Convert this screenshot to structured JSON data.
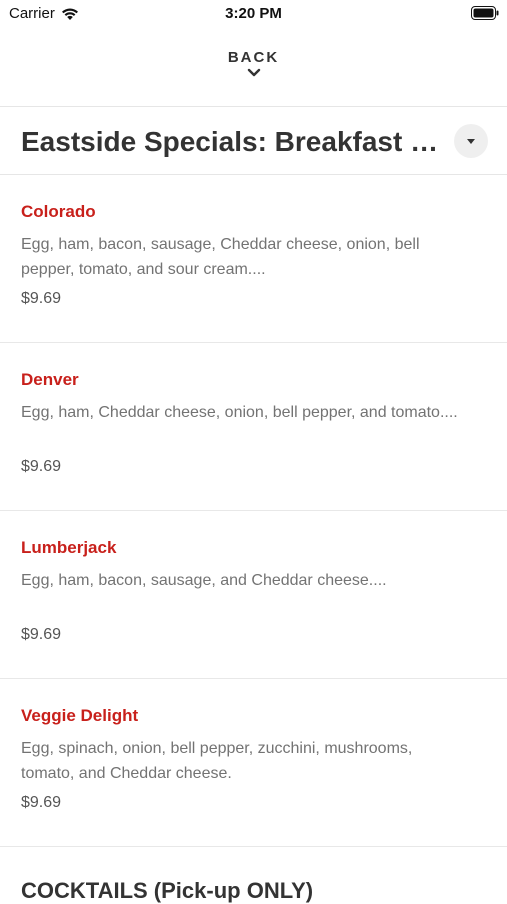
{
  "status_bar": {
    "carrier": "Carrier",
    "time": "3:20 PM"
  },
  "nav": {
    "back_label": "BACK"
  },
  "category": {
    "title": "Eastside Specials: Breakfast P..."
  },
  "menu_items": [
    {
      "name": "Colorado",
      "description": "Egg, ham, bacon, sausage, Cheddar cheese, onion, bell pepper, tomato, and sour cream....",
      "price": "$9.69"
    },
    {
      "name": "Denver",
      "description": "Egg, ham, Cheddar cheese, onion, bell pepper, and tomato....",
      "price": "$9.69"
    },
    {
      "name": "Lumberjack",
      "description": "Egg, ham, bacon, sausage, and Cheddar cheese....",
      "price": "$9.69"
    },
    {
      "name": "Veggie Delight",
      "description": "Egg, spinach, onion, bell pepper, zucchini, mushrooms, tomato, and Cheddar cheese.",
      "price": "$9.69"
    }
  ],
  "next_section": {
    "title": "COCKTAILS  (Pick-up ONLY)"
  },
  "colors": {
    "item_name": "#c8201b",
    "text_dark": "#333333",
    "text_muted": "#737373",
    "divider": "#e8e8e8"
  }
}
